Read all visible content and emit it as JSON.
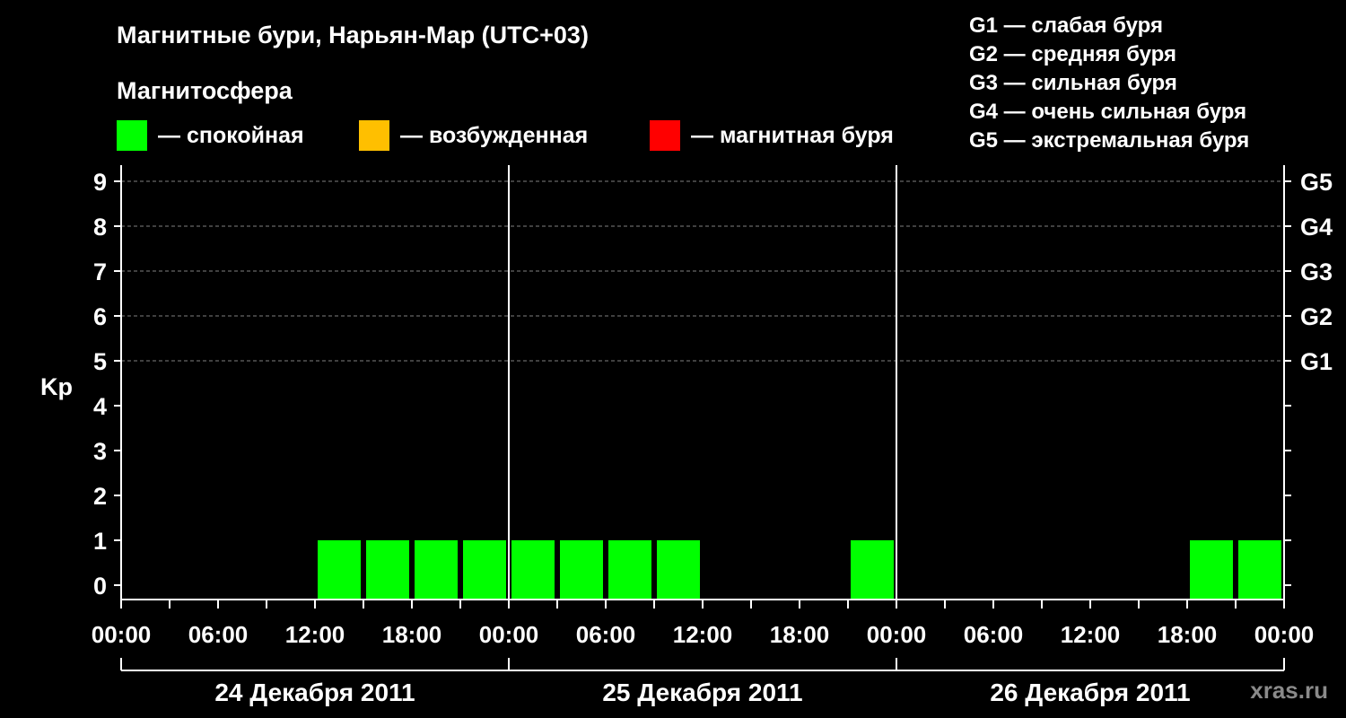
{
  "header": {
    "title": "Магнитные бури, Нарьян-Мар (UTC+03)",
    "magnetosphere_label": "Магнитосфера"
  },
  "legend": {
    "items": [
      {
        "label": "— спокойная",
        "color": "#00ff00"
      },
      {
        "label": "— возбужденная",
        "color": "#ffbf00"
      },
      {
        "label": "— магнитная буря",
        "color": "#ff0000"
      }
    ]
  },
  "g_legend": [
    "G1 — слабая буря",
    "G2 — средняя буря",
    "G3 — сильная буря",
    "G4 — очень сильная буря",
    "G5 — экстремальная буря"
  ],
  "watermark": "xras.ru",
  "chart_data": {
    "type": "bar",
    "title": "Магнитные бури, Нарьян-Мар (UTC+03)",
    "ylabel": "Kp",
    "ylim": [
      0,
      9
    ],
    "yticks": [
      "0",
      "1",
      "2",
      "3",
      "4",
      "5",
      "6",
      "7",
      "8",
      "9"
    ],
    "right_labels": [
      {
        "kp": 5,
        "label": "G1"
      },
      {
        "kp": 6,
        "label": "G2"
      },
      {
        "kp": 7,
        "label": "G3"
      },
      {
        "kp": 8,
        "label": "G4"
      },
      {
        "kp": 9,
        "label": "G5"
      }
    ],
    "x_tick_labels": [
      "00:00",
      "06:00",
      "12:00",
      "18:00",
      "00:00",
      "06:00",
      "12:00",
      "18:00",
      "00:00",
      "06:00",
      "12:00",
      "18:00",
      "00:00"
    ],
    "days": [
      "24 Декабря 2011",
      "25 Декабря 2011",
      "26 Декабря 2011"
    ],
    "interval_hours": 3,
    "series": [
      {
        "values": [
          0,
          0,
          0,
          0,
          1,
          1,
          1,
          1,
          1,
          1,
          1,
          1,
          0,
          0,
          0,
          1,
          0,
          0,
          0,
          0,
          0,
          0,
          1,
          1
        ],
        "colors": [
          "#00ff00",
          "#00ff00",
          "#00ff00",
          "#00ff00",
          "#00ff00",
          "#00ff00",
          "#00ff00",
          "#00ff00",
          "#00ff00",
          "#00ff00",
          "#00ff00",
          "#00ff00",
          "#00ff00",
          "#00ff00",
          "#00ff00",
          "#00ff00",
          "#00ff00",
          "#00ff00",
          "#00ff00",
          "#00ff00",
          "#00ff00",
          "#00ff00",
          "#00ff00",
          "#00ff00"
        ]
      }
    ],
    "grid": true
  }
}
